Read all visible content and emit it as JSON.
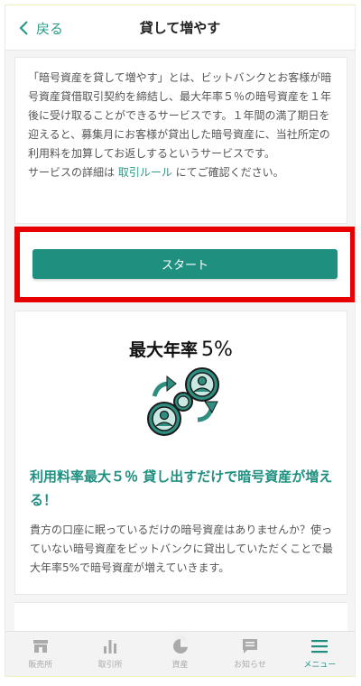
{
  "header": {
    "back_label": "戻る",
    "title": "貸して増やす"
  },
  "description": {
    "para1": "「暗号資産を貸して増やす」とは、ビットバンクとお客様が暗号資産貸借取引契約を締結し、最大年率５％の暗号資産を１年後に受け取ることができるサービスです。１年間の満了期日を迎えると、募集月にお客様が貸出した暗号資産に、当社所定の利用料を加算してお返しするというサービスです。",
    "para2_prefix": "サービスの詳細は ",
    "para2_link": "取引ルール",
    "para2_suffix": " にてご確認ください。"
  },
  "start": {
    "label": "スタート"
  },
  "feature": {
    "rate_label": "最大年率",
    "rate_value": "5%",
    "heading": "利用料率最大５％ 貸し出すだけで暗号資産が増える！",
    "body": "貴方の口座に眠っているだけの暗号資産はありませんか？使っていない暗号資産をビットバンクに貸出していただくことで最大年率5%で暗号資産が増えていきます。"
  },
  "tabbar": {
    "items": [
      {
        "label": "販売所",
        "icon": "store-icon",
        "active": false
      },
      {
        "label": "取引所",
        "icon": "bar-chart-icon",
        "active": false
      },
      {
        "label": "資産",
        "icon": "pie-chart-icon",
        "active": false
      },
      {
        "label": "お知らせ",
        "icon": "message-icon",
        "active": false
      },
      {
        "label": "メニュー",
        "icon": "menu-icon",
        "active": true
      }
    ]
  },
  "colors": {
    "accent": "#1f8f80",
    "link": "#2b9b87",
    "highlight": "#e60000",
    "inactive_tab": "#aaaaaa"
  }
}
